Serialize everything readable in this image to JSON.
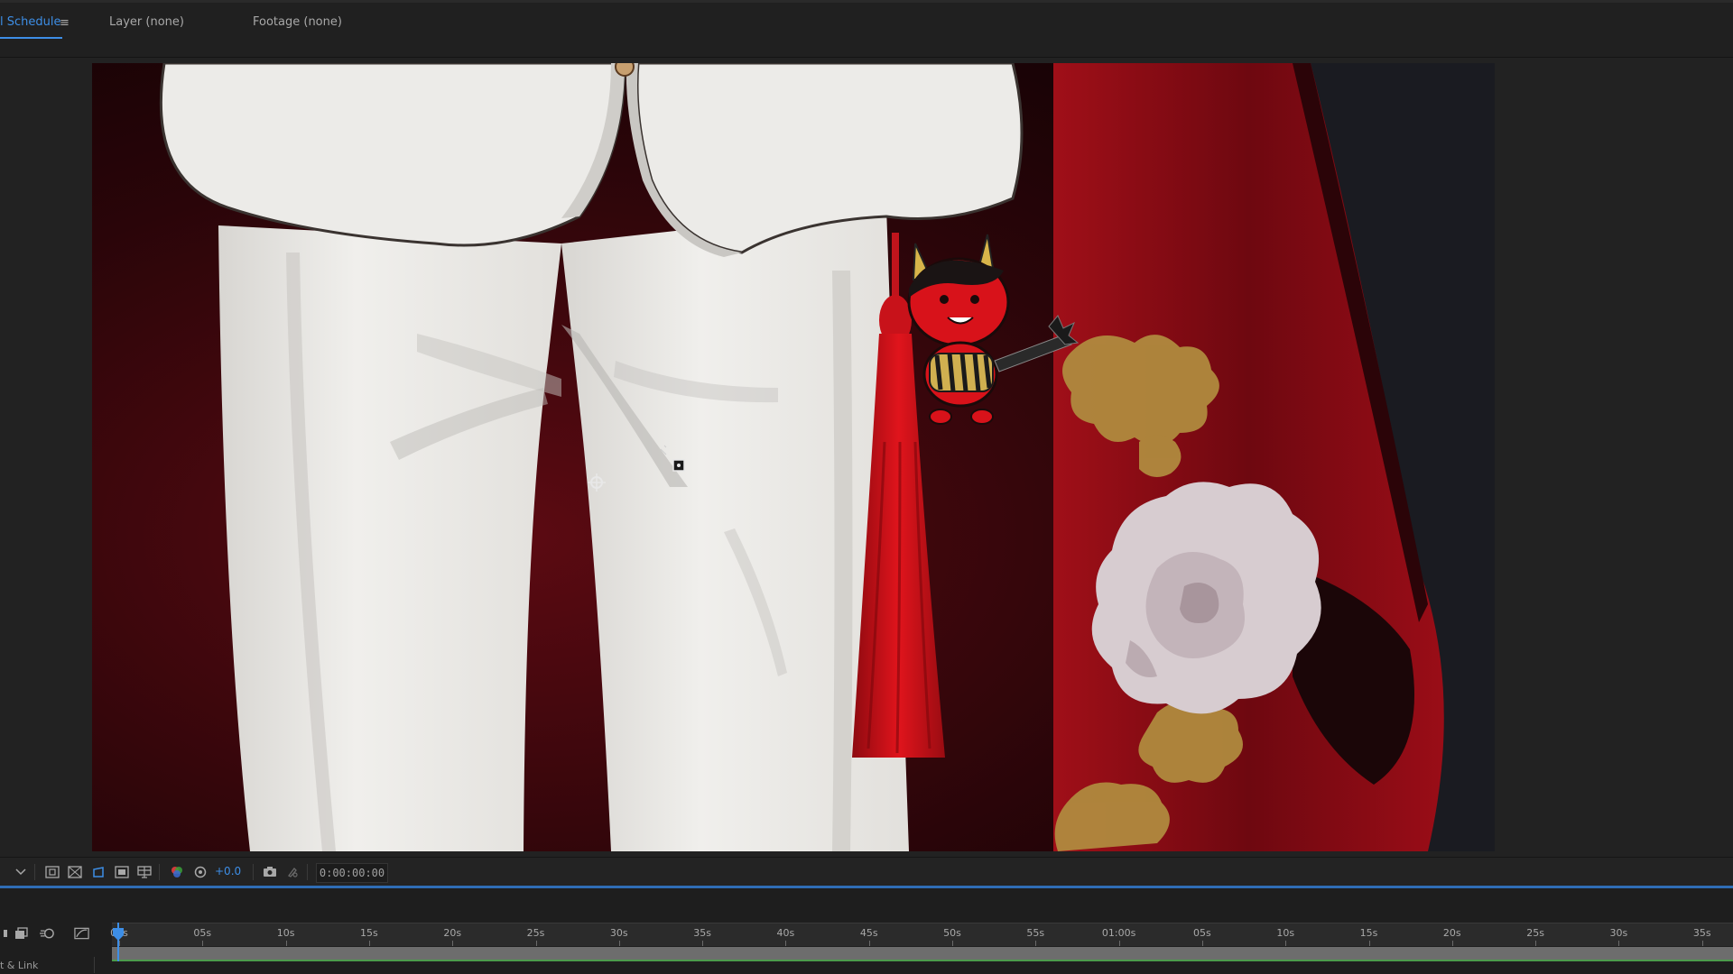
{
  "tabs": [
    {
      "label": "l Schedule",
      "active": true
    },
    {
      "label": "Layer (none)",
      "active": false
    },
    {
      "label": "Footage (none)",
      "active": false
    }
  ],
  "tab_menu_glyph": "≡",
  "viewer_toolbar": {
    "exposure": "+0.0",
    "timecode": "0:00:00:00",
    "icons": [
      "dropdown-chevron-icon",
      "region-of-interest-icon",
      "transparency-grid-icon",
      "mask-path-icon",
      "safe-margins-icon",
      "grid-guides-icon",
      "color-channels-icon",
      "reset-exposure-icon",
      "snapshot-camera-icon",
      "show-snapshot-icon"
    ]
  },
  "timeline": {
    "ruler_ticks": [
      "00s",
      "05s",
      "10s",
      "15s",
      "20s",
      "25s",
      "30s",
      "35s",
      "40s",
      "45s",
      "50s",
      "55s",
      "01:00s",
      "05s",
      "10s",
      "15s",
      "20s",
      "25s",
      "30s",
      "35s"
    ],
    "label": "t & Link",
    "icons": [
      "composition-flowchart-icon",
      "draft-3d-icon",
      "motion-blur-icon",
      "graph-editor-icon"
    ]
  },
  "colors": {
    "accent": "#3d8ee6",
    "divider": "#2f6db5",
    "workarea": "#6d6d6d",
    "red_curtain": "#7a0a12"
  }
}
